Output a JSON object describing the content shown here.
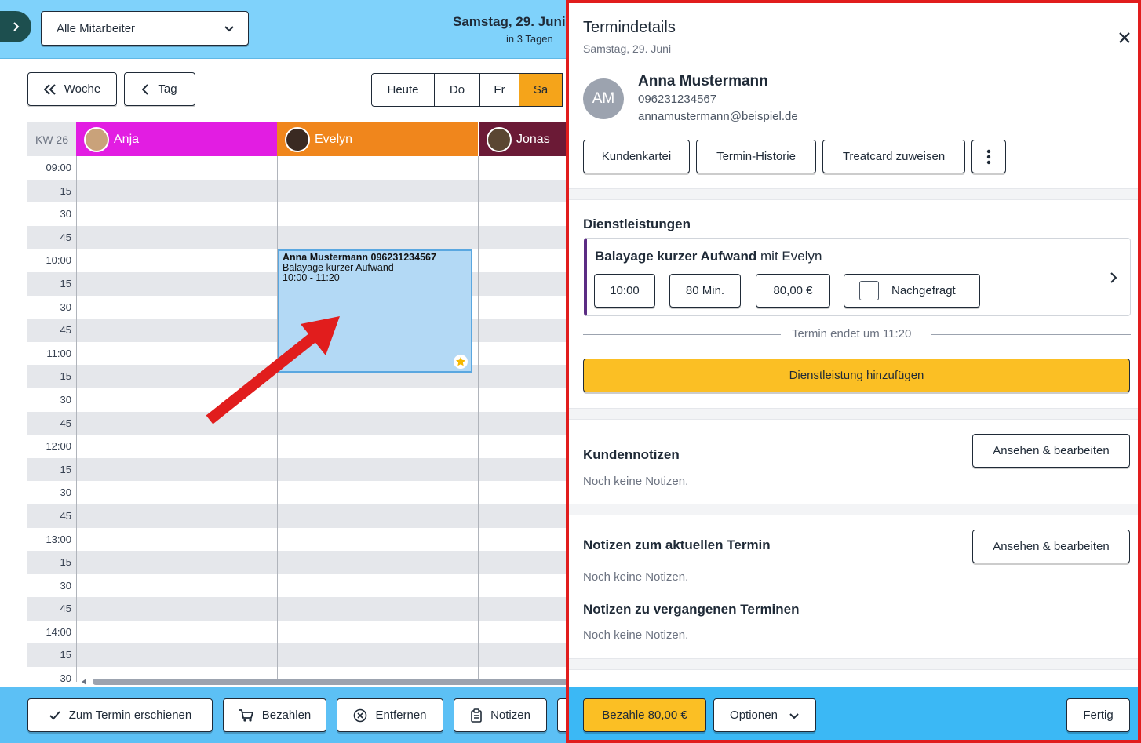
{
  "header": {
    "staff_select": "Alle Mitarbeiter",
    "date": "Samstag, 29. Juni",
    "relative": "in 3 Tagen"
  },
  "nav": {
    "week": "Woche",
    "day": "Tag",
    "today": "Heute",
    "days": [
      "Do",
      "Fr",
      "Sa"
    ]
  },
  "calendar": {
    "week_label": "KW 26",
    "staff": [
      {
        "name": "Anja",
        "color": "#e21de2"
      },
      {
        "name": "Evelyn",
        "color": "#f0861c"
      },
      {
        "name": "Jonas",
        "color": "#6b1a36"
      }
    ],
    "times": [
      "09:00",
      "15",
      "30",
      "45",
      "10:00",
      "15",
      "30",
      "45",
      "11:00",
      "15",
      "30",
      "45",
      "12:00",
      "15",
      "30",
      "45",
      "13:00",
      "15",
      "30",
      "45",
      "14:00",
      "15",
      "30"
    ],
    "appointment": {
      "title": "Anna Mustermann  096231234567",
      "service": "Balayage kurzer Aufwand",
      "time": "10:00 - 11:20"
    }
  },
  "bottom_actions": {
    "arrived": "Zum Termin erschienen",
    "pay": "Bezahlen",
    "remove": "Entfernen",
    "notes": "Notizen"
  },
  "panel": {
    "title": "Termindetails",
    "subtitle": "Samstag, 29. Juni",
    "customer": {
      "initials": "AM",
      "name": "Anna Mustermann",
      "phone": "096231234567",
      "email": "annamustermann@beispiel.de"
    },
    "actions": {
      "file": "Kundenkartei",
      "history": "Termin-Historie",
      "treatcard": "Treatcard zuweisen"
    },
    "services_heading": "Dienstleistungen",
    "service": {
      "name": "Balayage kurzer Aufwand",
      "with": "mit Evelyn",
      "start": "10:00",
      "duration": "80 Min.",
      "price": "80,00 €",
      "requested": "Nachgefragt"
    },
    "ends": "Termin endet um 11:20",
    "add_service": "Dienstleistung hinzufügen",
    "customer_notes": {
      "heading": "Kundennotizen",
      "button": "Ansehen & bearbeiten",
      "empty": "Noch keine Notizen."
    },
    "current_notes": {
      "heading": "Notizen zum aktuellen Termin",
      "button": "Ansehen & bearbeiten",
      "empty": "Noch keine Notizen."
    },
    "past_notes": {
      "heading": "Notizen zu vergangenen Terminen",
      "empty": "Noch keine Notizen."
    },
    "footer": {
      "pay": "Bezahle 80,00 €",
      "options": "Optionen",
      "done": "Fertig"
    }
  },
  "colors": {
    "topbar": "#7fd2fb",
    "accent": "#fbbf24",
    "highlight_border": "#e11d1d",
    "appointment": "#b3d9f5"
  }
}
